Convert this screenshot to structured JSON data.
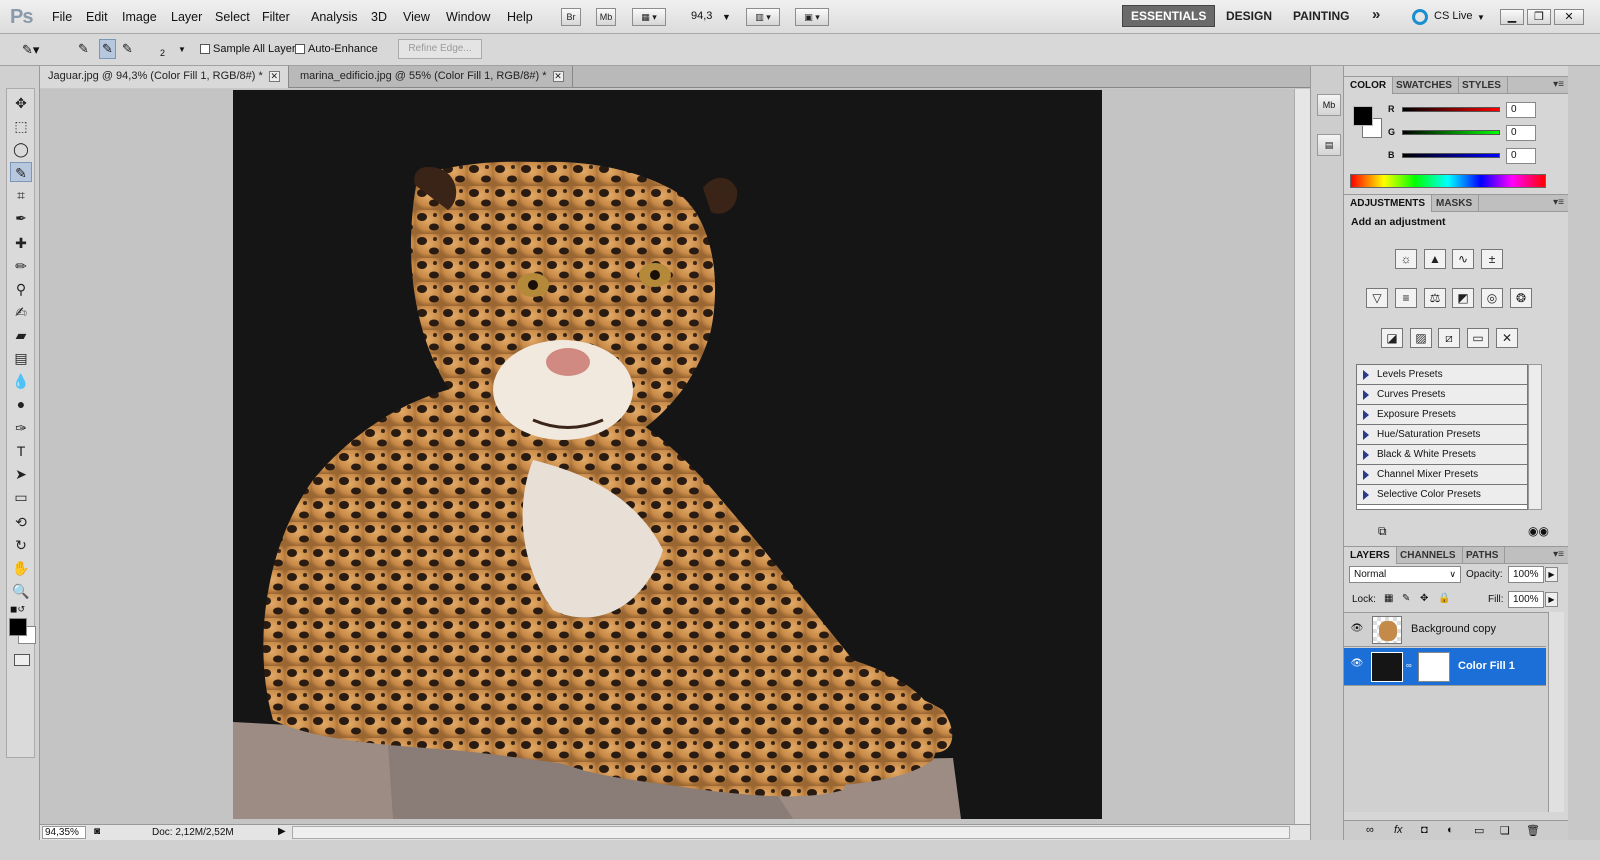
{
  "app": {
    "logo": "Ps"
  },
  "menu": [
    "File",
    "Edit",
    "Image",
    "Layer",
    "Select",
    "Filter",
    "Analysis",
    "3D",
    "View",
    "Window",
    "Help"
  ],
  "menubar": {
    "br": "Br",
    "mb": "Mb",
    "zoom": "94,3"
  },
  "workspaces": {
    "essentials": "ESSENTIALS",
    "design": "DESIGN",
    "painting": "PAINTING",
    "more": "»",
    "cs_live": "CS Live"
  },
  "options": {
    "brush_size": "2",
    "sample_all_layers": "Sample All Layers",
    "auto_enhance": "Auto-Enhance",
    "refine_edge": "Refine Edge..."
  },
  "tabs": [
    {
      "label": "Jaguar.jpg @ 94,3% (Color Fill 1, RGB/8#) *"
    },
    {
      "label": "marina_edificio.jpg @ 55% (Color Fill 1, RGB/8#) *"
    }
  ],
  "status": {
    "zoom": "94,35%",
    "doc": "Doc: 2,12M/2,52M"
  },
  "color_panel": {
    "tabs": [
      "COLOR",
      "SWATCHES",
      "STYLES"
    ],
    "r_label": "R",
    "g_label": "G",
    "b_label": "B",
    "r": "0",
    "g": "0",
    "b": "0",
    "fg": "#000000",
    "bg": "#ffffff"
  },
  "adjustments": {
    "tabs": [
      "ADJUSTMENTS",
      "MASKS"
    ],
    "heading": "Add an adjustment",
    "presets": [
      "Levels Presets",
      "Curves Presets",
      "Exposure Presets",
      "Hue/Saturation Presets",
      "Black & White Presets",
      "Channel Mixer Presets",
      "Selective Color Presets"
    ]
  },
  "layers_panel": {
    "tabs": [
      "LAYERS",
      "CHANNELS",
      "PATHS"
    ],
    "blend_mode": "Normal",
    "opacity_label": "Opacity:",
    "opacity": "100%",
    "lock_label": "Lock:",
    "fill_label": "Fill:",
    "fill": "100%",
    "layers": [
      {
        "name": "Background copy"
      },
      {
        "name": "Color Fill 1"
      }
    ]
  },
  "colors": {
    "accent": "#1c6fd6",
    "canvas_bg": "#151515"
  }
}
